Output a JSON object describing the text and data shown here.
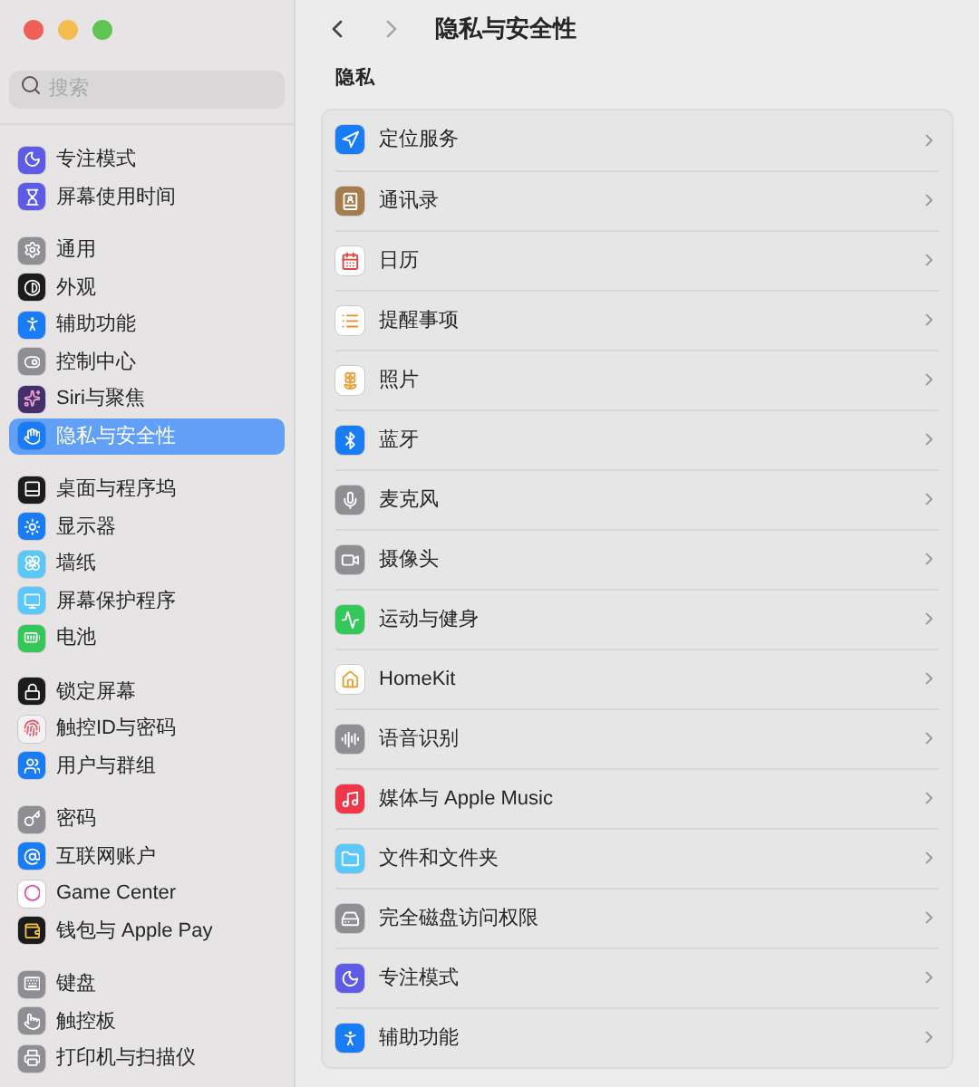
{
  "sidebar": {
    "search": {
      "placeholder": "搜索"
    },
    "groups": [
      [
        {
          "label": "专注模式",
          "selected": false
        },
        {
          "label": "屏幕使用时间",
          "selected": false
        }
      ],
      [
        {
          "label": "通用",
          "selected": false
        },
        {
          "label": "外观",
          "selected": false
        },
        {
          "label": "辅助功能",
          "selected": false
        },
        {
          "label": "控制中心",
          "selected": false
        },
        {
          "label": "Siri与聚焦",
          "selected": false
        },
        {
          "label": "隐私与安全性",
          "selected": true
        }
      ],
      [
        {
          "label": "桌面与程序坞",
          "selected": false
        },
        {
          "label": "显示器",
          "selected": false
        },
        {
          "label": "墙纸",
          "selected": false
        },
        {
          "label": "屏幕保护程序",
          "selected": false
        },
        {
          "label": "电池",
          "selected": false
        }
      ],
      [
        {
          "label": "锁定屏幕",
          "selected": false
        },
        {
          "label": "触控ID与密码",
          "selected": false
        },
        {
          "label": "用户与群组",
          "selected": false
        }
      ],
      [
        {
          "label": "密码",
          "selected": false
        },
        {
          "label": "互联网账户",
          "selected": false
        },
        {
          "label": "Game Center",
          "selected": false
        },
        {
          "label": "钱包与 Apple Pay",
          "selected": false
        }
      ],
      [
        {
          "label": "键盘",
          "selected": false
        },
        {
          "label": "触控板",
          "selected": false
        },
        {
          "label": "打印机与扫描仪",
          "selected": false
        }
      ]
    ]
  },
  "main": {
    "title": "隐私与安全性",
    "section": "隐私",
    "rows": [
      "定位服务",
      "通讯录",
      "日历",
      "提醒事项",
      "照片",
      "蓝牙",
      "麦克风",
      "摄像头",
      "运动与健身",
      "HomeKit",
      "语音识别",
      "媒体与 Apple Music",
      "文件和文件夹",
      "完全磁盘访问权限",
      "专注模式",
      "辅助功能"
    ]
  }
}
